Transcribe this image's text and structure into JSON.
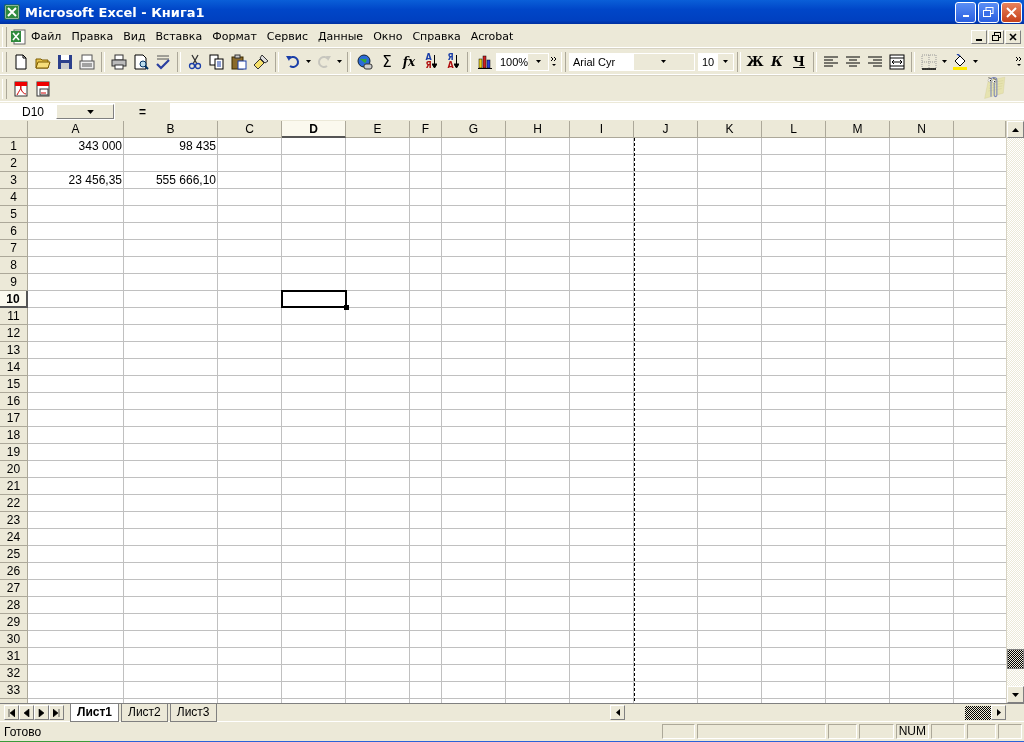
{
  "window": {
    "title": "Microsoft Excel - Книга1"
  },
  "menu": [
    "Файл",
    "Правка",
    "Вид",
    "Вставка",
    "Формат",
    "Сервис",
    "Данные",
    "Окно",
    "Справка",
    "Acrobat"
  ],
  "toolbar": {
    "undo": {
      "disabled": false
    },
    "redo": {
      "disabled": true
    },
    "sum_label": "Σ",
    "function_label": "fx",
    "sort_buttons": [
      {
        "top": "А",
        "bottom": "Я"
      },
      {
        "top": "Я",
        "bottom": "А"
      }
    ],
    "zoom": "100%",
    "font": "Arial Cyr",
    "font_size": "10",
    "format_buttons": [
      "Ж",
      "К",
      "Ч"
    ]
  },
  "formula_bar": {
    "name_box": "D10",
    "label": "="
  },
  "columns": [
    {
      "label": "A",
      "selected": false,
      "page_break": false
    },
    {
      "label": "B",
      "selected": false,
      "page_break": false
    },
    {
      "label": "C",
      "selected": false,
      "page_break": false
    },
    {
      "label": "D",
      "selected": true,
      "page_break": false
    },
    {
      "label": "E",
      "selected": false,
      "page_break": false
    },
    {
      "label": "F",
      "selected": false,
      "page_break": false
    },
    {
      "label": "G",
      "selected": false,
      "page_break": false
    },
    {
      "label": "H",
      "selected": false,
      "page_break": false
    },
    {
      "label": "I",
      "selected": false,
      "page_break": true
    },
    {
      "label": "J",
      "selected": false,
      "page_break": false
    },
    {
      "label": "K",
      "selected": false,
      "page_break": false
    },
    {
      "label": "L",
      "selected": false,
      "page_break": false
    },
    {
      "label": "M",
      "selected": false,
      "page_break": false
    },
    {
      "label": "N",
      "selected": false,
      "page_break": false
    }
  ],
  "rows": [
    {
      "label": "1",
      "selected": false,
      "cells": [
        "343 000",
        "98 435"
      ]
    },
    {
      "label": "2",
      "selected": false
    },
    {
      "label": "3",
      "selected": false,
      "cells": [
        "23 456,35",
        "555 666,10"
      ]
    },
    {
      "label": "4",
      "selected": false
    },
    {
      "label": "5",
      "selected": false
    },
    {
      "label": "6",
      "selected": false
    },
    {
      "label": "7",
      "selected": false
    },
    {
      "label": "8",
      "selected": false
    },
    {
      "label": "9",
      "selected": false
    },
    {
      "label": "10",
      "selected": true
    },
    {
      "label": "11",
      "selected": false
    },
    {
      "label": "12",
      "selected": false
    },
    {
      "label": "13",
      "selected": false
    },
    {
      "label": "14",
      "selected": false
    },
    {
      "label": "15",
      "selected": false
    },
    {
      "label": "16",
      "selected": false
    },
    {
      "label": "17",
      "selected": false
    },
    {
      "label": "18",
      "selected": false
    },
    {
      "label": "19",
      "selected": false
    },
    {
      "label": "20",
      "selected": false
    },
    {
      "label": "21",
      "selected": false
    },
    {
      "label": "22",
      "selected": false
    },
    {
      "label": "23",
      "selected": false
    },
    {
      "label": "24",
      "selected": false
    },
    {
      "label": "25",
      "selected": false
    },
    {
      "label": "26",
      "selected": false
    },
    {
      "label": "27",
      "selected": false
    },
    {
      "label": "28",
      "selected": false
    },
    {
      "label": "29",
      "selected": false
    },
    {
      "label": "30",
      "selected": false
    },
    {
      "label": "31",
      "selected": false
    },
    {
      "label": "32",
      "selected": false
    },
    {
      "label": "33",
      "selected": false
    }
  ],
  "sheet_tabs": [
    {
      "label": "Лист1",
      "selected": true
    },
    {
      "label": "Лист2",
      "selected": false
    },
    {
      "label": "Лист3",
      "selected": false
    }
  ],
  "status_bar": {
    "text": "Готово",
    "num_indicator": "NUM"
  }
}
